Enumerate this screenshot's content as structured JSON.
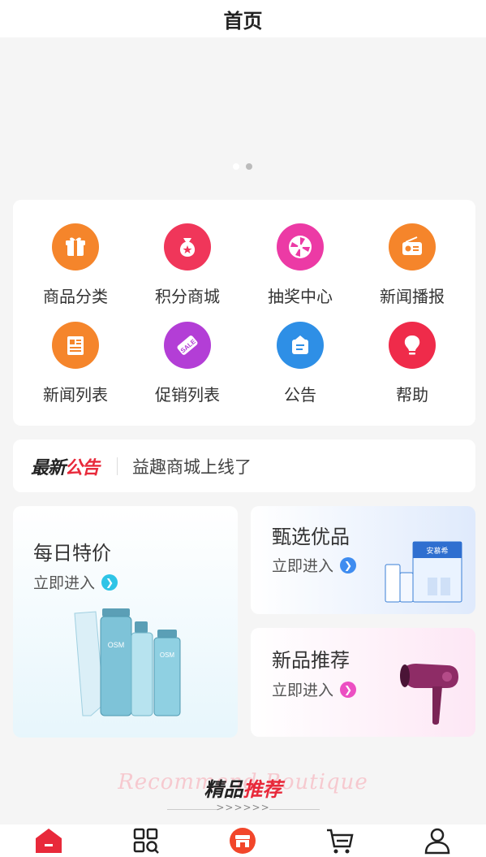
{
  "header": {
    "title": "首页"
  },
  "banner": {
    "slides": 2,
    "active_index": 1
  },
  "grid": [
    {
      "label": "商品分类",
      "icon": "gift-icon",
      "color": "#f5852b"
    },
    {
      "label": "积分商城",
      "icon": "money-bag-icon",
      "color": "#f0365a"
    },
    {
      "label": "抽奖中心",
      "icon": "lottery-wheel-icon",
      "color": "#ec3aa5"
    },
    {
      "label": "新闻播报",
      "icon": "radio-icon",
      "color": "#f5852b"
    },
    {
      "label": "新闻列表",
      "icon": "newspaper-icon",
      "color": "#f5852b"
    },
    {
      "label": "促销列表",
      "icon": "sale-tag-icon",
      "color": "#b33ed6"
    },
    {
      "label": "公告",
      "icon": "notice-board-icon",
      "color": "#2e8fe6"
    },
    {
      "label": "帮助",
      "icon": "lightbulb-icon",
      "color": "#ef2b4a"
    }
  ],
  "notice": {
    "tag_part1": "最新",
    "tag_part2": "公告",
    "text": "益趣商城上线了"
  },
  "promos": {
    "daily": {
      "title": "每日特价",
      "enter": "立即进入",
      "accent": "#2ec4e6"
    },
    "select": {
      "title": "甄选优品",
      "enter": "立即进入",
      "accent": "#3f8cf0"
    },
    "new": {
      "title": "新品推荐",
      "enter": "立即进入",
      "accent": "#ec4fc2"
    }
  },
  "recommend": {
    "bg_text": "Recommend Boutique",
    "title_part1": "精品",
    "title_part2": "推荐",
    "arrows": ">>>>>>"
  },
  "tabbar": [
    {
      "name": "home-icon",
      "active": true
    },
    {
      "name": "category-icon",
      "active": false
    },
    {
      "name": "store-icon",
      "active": false
    },
    {
      "name": "cart-icon",
      "active": false
    },
    {
      "name": "user-icon",
      "active": false
    }
  ],
  "colors": {
    "accent": "#e8293a",
    "background": "#f5f5f5"
  }
}
